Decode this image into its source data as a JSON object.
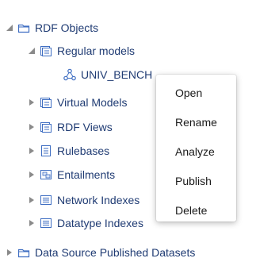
{
  "tree": {
    "root": {
      "label": "RDF Objects"
    },
    "regular_models": {
      "label": "Regular models"
    },
    "model_item": {
      "label": "UNIV_BENCH"
    },
    "virtual_models": {
      "label": "Virtual Models"
    },
    "rdf_views": {
      "label": "RDF Views"
    },
    "rulebases": {
      "label": "Rulebases"
    },
    "entailments": {
      "label": "Entailments"
    },
    "network_indexes": {
      "label": "Network Indexes"
    },
    "datatype_indexes": {
      "label": "Datatype Indexes"
    },
    "published_datasets": {
      "label": "Data Source Published Datasets"
    }
  },
  "context_menu": {
    "items": [
      "Open",
      "Rename",
      "Analyze",
      "Publish",
      "Delete"
    ]
  },
  "colors": {
    "tree_text": "#1f3b73",
    "folder_stroke": "#3f6ec2",
    "twisty": "#8a8a8a",
    "menu_text": "#1a1a1a"
  }
}
